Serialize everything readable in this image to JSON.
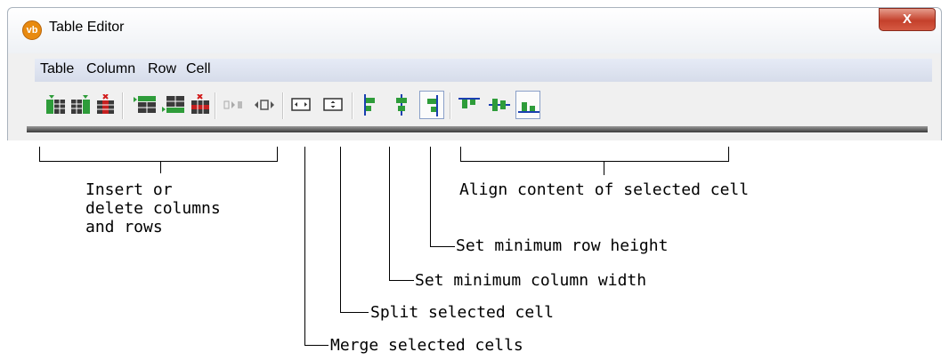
{
  "window": {
    "title": "Table Editor",
    "app_icon_text": "vb",
    "close_glyph": "X"
  },
  "menu": [
    "Table",
    "Column",
    "Row",
    "Cell"
  ],
  "toolbar": {
    "buttons": [
      {
        "name": "insert-column-left-icon",
        "pressed": false
      },
      {
        "name": "insert-column-right-icon",
        "pressed": false
      },
      {
        "name": "delete-column-icon",
        "pressed": false
      },
      {
        "name": "insert-row-above-icon",
        "pressed": false
      },
      {
        "name": "insert-row-below-icon",
        "pressed": false
      },
      {
        "name": "delete-row-icon",
        "pressed": false
      },
      {
        "name": "merge-cells-icon",
        "pressed": false
      },
      {
        "name": "split-cell-icon",
        "pressed": false
      },
      {
        "name": "min-column-width-icon",
        "pressed": false
      },
      {
        "name": "min-row-height-icon",
        "pressed": false
      },
      {
        "name": "align-left-icon",
        "pressed": false
      },
      {
        "name": "align-center-icon",
        "pressed": false
      },
      {
        "name": "align-right-icon",
        "pressed": true
      },
      {
        "name": "align-top-icon",
        "pressed": false
      },
      {
        "name": "align-middle-icon",
        "pressed": false
      },
      {
        "name": "align-bottom-icon",
        "pressed": true
      }
    ]
  },
  "annotations": {
    "insert_delete": "Insert or\ndelete columns\nand rows",
    "align": "Align content of selected cell",
    "min_row_height": "Set minimum row height",
    "min_col_width": "Set minimum column width",
    "split": "Split selected cell",
    "merge": "Merge selected cells"
  },
  "colors": {
    "icon_green": "#2e9c3a",
    "icon_red": "#d21c1c",
    "icon_blue": "#1a3fb0",
    "icon_dark": "#3a3a3a"
  }
}
